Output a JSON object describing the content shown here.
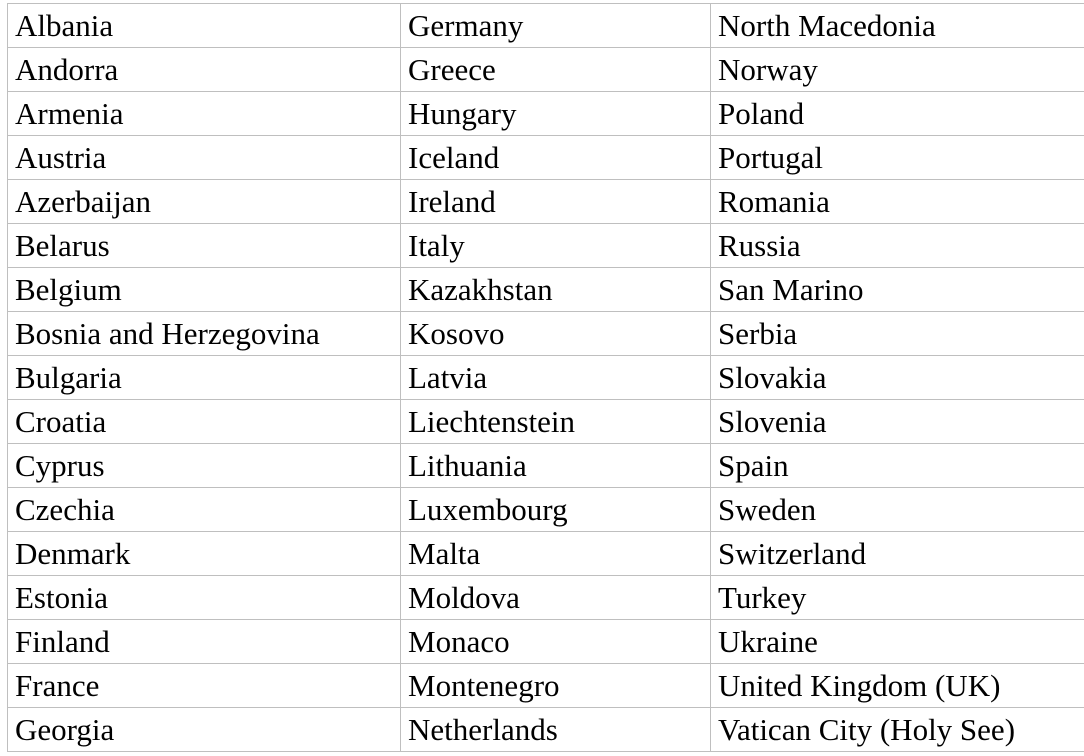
{
  "table": {
    "columns": 3,
    "row_count": 17,
    "border_color": "#bfbfbf",
    "text_color": "#000000",
    "background_color": "#ffffff",
    "rows": [
      {
        "c1": "Albania",
        "c2": "Germany",
        "c3": "North Macedonia"
      },
      {
        "c1": "Andorra",
        "c2": "Greece",
        "c3": "Norway"
      },
      {
        "c1": "Armenia",
        "c2": "Hungary",
        "c3": "Poland"
      },
      {
        "c1": "Austria",
        "c2": "Iceland",
        "c3": "Portugal"
      },
      {
        "c1": "Azerbaijan",
        "c2": "Ireland",
        "c3": "Romania"
      },
      {
        "c1": "Belarus",
        "c2": "Italy",
        "c3": "Russia"
      },
      {
        "c1": "Belgium",
        "c2": "Kazakhstan",
        "c3": "San Marino"
      },
      {
        "c1": "Bosnia and Herzegovina",
        "c2": "Kosovo",
        "c3": "Serbia"
      },
      {
        "c1": "Bulgaria",
        "c2": "Latvia",
        "c3": "Slovakia"
      },
      {
        "c1": "Croatia",
        "c2": "Liechtenstein",
        "c3": "Slovenia"
      },
      {
        "c1": "Cyprus",
        "c2": "Lithuania",
        "c3": "Spain"
      },
      {
        "c1": "Czechia",
        "c2": "Luxembourg",
        "c3": "Sweden"
      },
      {
        "c1": "Denmark",
        "c2": "Malta",
        "c3": "Switzerland"
      },
      {
        "c1": "Estonia",
        "c2": "Moldova",
        "c3": "Turkey"
      },
      {
        "c1": "Finland",
        "c2": "Monaco",
        "c3": "Ukraine"
      },
      {
        "c1": "France",
        "c2": "Montenegro",
        "c3": "United Kingdom (UK)"
      },
      {
        "c1": "Georgia",
        "c2": "Netherlands",
        "c3": "Vatican City (Holy See)"
      }
    ]
  }
}
